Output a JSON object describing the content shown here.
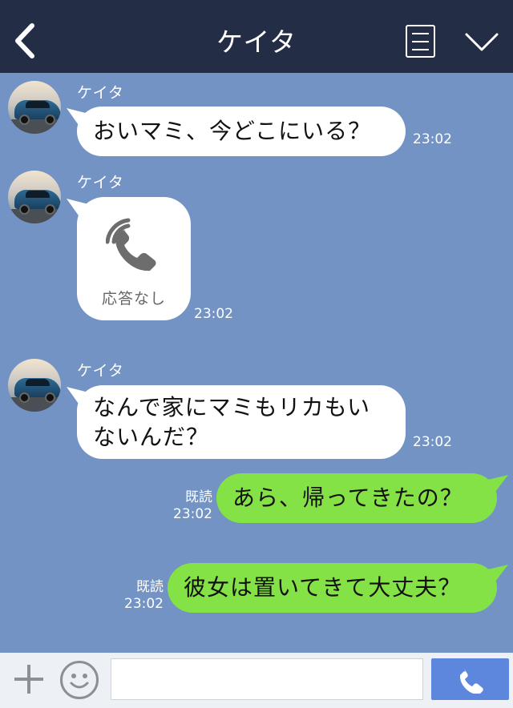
{
  "header": {
    "title": "ケイタ"
  },
  "messages": [
    {
      "sender": "ケイタ",
      "text": "おいマミ、今どこにいる？",
      "time": "23:02"
    },
    {
      "sender": "ケイタ",
      "call_label": "応答なし",
      "time": "23:02"
    },
    {
      "sender": "ケイタ",
      "text_line1": "なんで家にマミもリカもい",
      "text_line2": "ないんだ？",
      "time": "23:02"
    },
    {
      "read": "既読",
      "time": "23:02",
      "text": "あら、帰ってきたの？"
    },
    {
      "read": "既読",
      "time": "23:02",
      "text": "彼女は置いてきて大丈夫？"
    }
  ],
  "colors": {
    "header_bg": "#232d45",
    "chat_bg": "#7293c3",
    "my_bubble": "#84e146",
    "their_bubble": "#ffffff",
    "send_button": "#5c87dc"
  },
  "icons": [
    "back-icon",
    "menu-icon",
    "chevron-down-icon",
    "phone-icon",
    "plus-icon",
    "smiley-icon",
    "send-phone-icon"
  ]
}
